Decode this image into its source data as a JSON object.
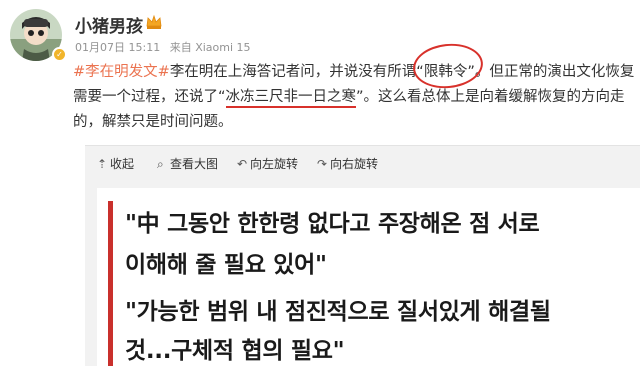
{
  "post": {
    "username": "小猪男孩",
    "date": "01月07日 15:11",
    "source": "来自 Xiaomi 15",
    "lines": {
      "l1_hashtag": "#李在明发文#",
      "l1_a": "李在明在上海答记者问，并说没有所谓“",
      "l1_b": "限韩令",
      "l1_c": "”。但正常的演出文化恢复",
      "l2_a": "需要一个过程，还说了“",
      "l2_b": "冰冻三尺非一日之寒",
      "l2_c": "”。这么看总体上是向着缓解恢复的方向走",
      "l3": "的，解禁只是时间问题。"
    }
  },
  "toolbar": {
    "collapse": "收起",
    "view_large": "查看大图",
    "rotate_left": "向左旋转",
    "rotate_right": "向右旋转"
  },
  "image_card": {
    "quote1_line1": "\"中 그동안 한한령 없다고 주장해온 점 서로",
    "quote1_line2": "이해해 줄 필요 있어\"",
    "quote2_line1": "\"가능한 범위 내 점진적으로 질서있게 해결될",
    "quote2_line2": "것...구체적 협의 필요\""
  },
  "colors": {
    "hashtag": "#eb7350",
    "annotation_red": "#d8312b",
    "card_accent": "#c9302c"
  }
}
